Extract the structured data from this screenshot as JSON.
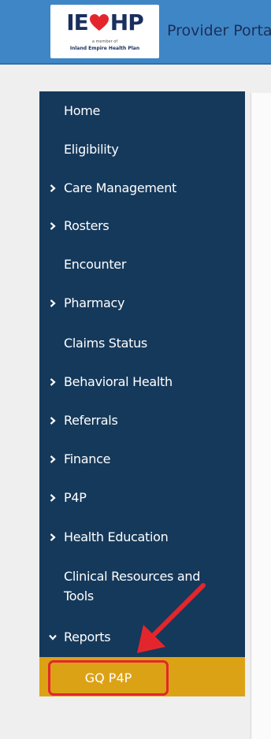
{
  "header": {
    "logo_left": "IE",
    "logo_right": "HP",
    "logo_tagline": "a member of",
    "logo_subtitle": "Inland Empire Health Plan",
    "portal_title": "Provider Portal",
    "header_color": "#3f86c6"
  },
  "sidebar": {
    "background": "#15395b",
    "items": [
      {
        "label": "Home",
        "has_chevron": false
      },
      {
        "label": "Eligibility",
        "has_chevron": false
      },
      {
        "label": "Care Management",
        "has_chevron": true,
        "chevron": "chevron-right-icon"
      },
      {
        "label": "Rosters",
        "has_chevron": true,
        "chevron": "chevron-right-icon"
      },
      {
        "label": "Encounter",
        "has_chevron": false
      },
      {
        "label": "Pharmacy",
        "has_chevron": true,
        "chevron": "chevron-right-icon"
      },
      {
        "label": "Claims Status",
        "has_chevron": false
      },
      {
        "label": "Behavioral Health",
        "has_chevron": true,
        "chevron": "chevron-right-icon"
      },
      {
        "label": "Referrals",
        "has_chevron": true,
        "chevron": "chevron-right-icon"
      },
      {
        "label": "Finance",
        "has_chevron": true,
        "chevron": "chevron-right-icon"
      },
      {
        "label": "P4P",
        "has_chevron": true,
        "chevron": "chevron-right-icon"
      },
      {
        "label": "Health Education",
        "has_chevron": true,
        "chevron": "chevron-right-icon"
      },
      {
        "label": "Clinical Resources and Tools",
        "has_chevron": false
      },
      {
        "label": "Reports",
        "has_chevron": true,
        "chevron": "chevron-down-icon",
        "expanded": true
      }
    ],
    "sub_item": {
      "label": "GQ P4P",
      "highlight_color": "#dca216",
      "annotation_color": "#e4262c"
    }
  }
}
